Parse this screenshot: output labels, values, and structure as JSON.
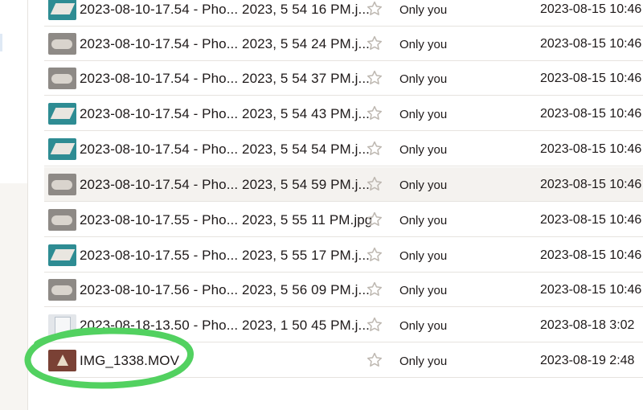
{
  "colors": {
    "text": "#1e1919",
    "divider": "#e6e3df",
    "hover_row": "#f4f2ef",
    "star_outline": "#bdb7b0",
    "annotation": "#52d160"
  },
  "annotation": {
    "shape": "hand-drawn ellipse",
    "target": "IMG_1338.MOV"
  },
  "files": [
    {
      "name": "2023-08-10-17.54 - Pho... 2023, 5 54 16 PM.j...",
      "access": "Only you",
      "modified": "2023-08-15 10:46",
      "thumb": "teal"
    },
    {
      "name": "2023-08-10-17.54 - Pho... 2023, 5 54 24 PM.j...",
      "access": "Only you",
      "modified": "2023-08-15 10:46",
      "thumb": "gray"
    },
    {
      "name": "2023-08-10-17.54 - Pho... 2023, 5 54 37 PM.j...",
      "access": "Only you",
      "modified": "2023-08-15 10:46",
      "thumb": "gray"
    },
    {
      "name": "2023-08-10-17.54 - Pho... 2023, 5 54 43 PM.j...",
      "access": "Only you",
      "modified": "2023-08-15 10:46",
      "thumb": "teal"
    },
    {
      "name": "2023-08-10-17.54 - Pho... 2023, 5 54 54 PM.j...",
      "access": "Only you",
      "modified": "2023-08-15 10:46",
      "thumb": "teal"
    },
    {
      "name": "2023-08-10-17.54 - Pho... 2023, 5 54 59 PM.j...",
      "access": "Only you",
      "modified": "2023-08-15 10:46",
      "thumb": "gray"
    },
    {
      "name": "2023-08-10-17.55 - Pho... 2023, 5 55 11 PM.jpg",
      "access": "Only you",
      "modified": "2023-08-15 10:46",
      "thumb": "gray"
    },
    {
      "name": "2023-08-10-17.55 - Pho... 2023, 5 55 17 PM.j...",
      "access": "Only you",
      "modified": "2023-08-15 10:46",
      "thumb": "teal"
    },
    {
      "name": "2023-08-10-17.56 - Pho... 2023, 5 56 09 PM.j...",
      "access": "Only you",
      "modified": "2023-08-15 10:46",
      "thumb": "gray"
    },
    {
      "name": "2023-08-18-13.50 - Pho... 2023, 1 50 45 PM.j...",
      "access": "Only you",
      "modified": "2023-08-18 3:02",
      "thumb": "light"
    },
    {
      "name": "IMG_1338.MOV",
      "access": "Only you",
      "modified": "2023-08-19 2:48",
      "thumb": "video"
    }
  ]
}
